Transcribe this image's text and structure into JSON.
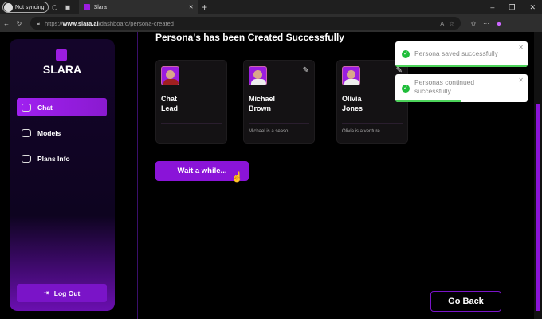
{
  "browser": {
    "profile": "Not syncing",
    "tab_title": "Slara",
    "url_prefix": "https://",
    "url_domain": "www.slara.ai",
    "url_path": "/dashboard/persona-created"
  },
  "sidebar": {
    "brand": "SLARA",
    "items": [
      {
        "label": "Chat",
        "active": true
      },
      {
        "label": "Models"
      },
      {
        "label": "Plans Info"
      }
    ],
    "logout": "Log Out"
  },
  "main": {
    "title": "Persona's has been Created Successfully",
    "personas": [
      {
        "name_line1": "Chat",
        "name_line2": "Lead",
        "description": ""
      },
      {
        "name_line1": "Michael",
        "name_line2": "Brown",
        "description": "Michael is a seaso..."
      },
      {
        "name_line1": "Olivia",
        "name_line2": "Jones",
        "description": "Olivia is a venture ..."
      }
    ],
    "wait_button": "Wait a while...",
    "go_back": "Go Back"
  },
  "toasts": [
    {
      "text": "Persona saved successfully",
      "progress": 1.0
    },
    {
      "text": "Personas continued successfully",
      "progress": 0.5
    }
  ],
  "colors": {
    "accent": "#8a14d8",
    "success": "#1fbd3a"
  }
}
